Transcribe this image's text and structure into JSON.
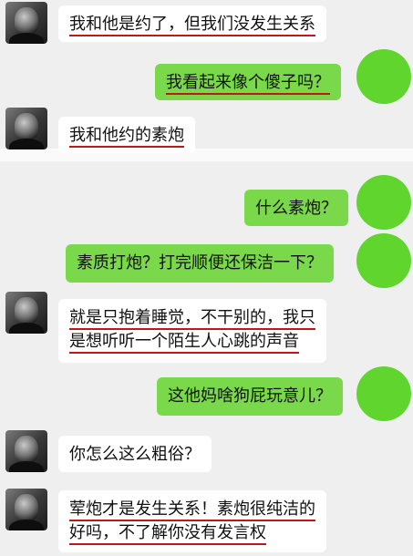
{
  "chat": {
    "messages": [
      {
        "side": "left",
        "lines": [
          "我和他是约了，但我们没发生关系"
        ]
      },
      {
        "side": "right",
        "lines": [
          "我看起来像个傻子吗？"
        ]
      },
      {
        "side": "left",
        "lines": [
          "我和他约的素炮"
        ]
      },
      {
        "side": "right",
        "lines": [
          "什么素炮？"
        ]
      },
      {
        "side": "right",
        "lines": [
          "素质打炮？打完顺便还保洁一下？"
        ]
      },
      {
        "side": "left",
        "lines": [
          "就是只抱着睡觉，不干别的，我只",
          "是想听听一个陌生人心跳的声音"
        ]
      },
      {
        "side": "right",
        "lines": [
          "这他妈啥狗屁玩意儿？"
        ]
      },
      {
        "side": "left",
        "lines": [
          "你怎么这么粗俗？"
        ]
      },
      {
        "side": "left",
        "lines": [
          "荤炮才是发生关系！素炮很纯洁的",
          "好吗，不了解你没有发言权"
        ]
      }
    ]
  }
}
